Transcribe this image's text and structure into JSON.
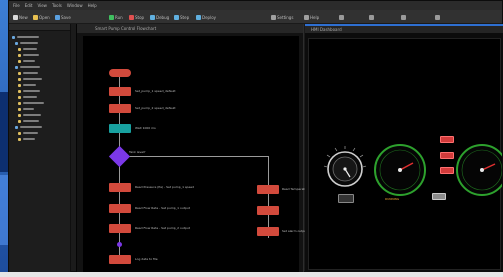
{
  "menubar": {
    "items": [
      "File",
      "Edit",
      "View",
      "Tools",
      "Window",
      "Help"
    ]
  },
  "toolbar": {
    "buttons": [
      {
        "label": "New",
        "color": "#d9d9d9"
      },
      {
        "label": "Open",
        "color": "#e8c050"
      },
      {
        "label": "Save",
        "color": "#5aa0e0"
      },
      {
        "label": "Run",
        "color": "#40c060"
      },
      {
        "label": "Stop",
        "color": "#e05050"
      },
      {
        "label": "Debug",
        "color": "#60b0e0"
      },
      {
        "label": "Step",
        "color": "#60b0e0"
      },
      {
        "label": "Deploy",
        "color": "#60b0e0"
      },
      {
        "label": "Settings",
        "color": "#a0a0a0"
      },
      {
        "label": "Help",
        "color": "#a0a0a0"
      }
    ]
  },
  "flow": {
    "tab_label": "Smart Pump Control Flowchart",
    "nodes": [
      {
        "kind": "start",
        "text": ""
      },
      {
        "kind": "block",
        "text": "Set_pump_1 speed_default"
      },
      {
        "kind": "block",
        "text": "Set_pump_2 speed_default"
      },
      {
        "kind": "teal",
        "text": "Wait 1000 ms"
      },
      {
        "kind": "decision",
        "text": "Tank level?"
      },
      {
        "kind": "block",
        "text": "Read Pressure (Pa) - Set pump_1 speed"
      },
      {
        "kind": "block",
        "text": "Read Flow Rate - Set pump_1 output"
      },
      {
        "kind": "block",
        "text": "Read Flow Rate - Set pump_2 output"
      },
      {
        "kind": "block",
        "text": "Read Temperature - Set fan speed"
      },
      {
        "kind": "block",
        "text": "Set alarm output"
      },
      {
        "kind": "block",
        "text": "Log data to file"
      }
    ]
  },
  "hmi": {
    "tab_label": "HMI Dashboard",
    "status_label": "RUNNING",
    "buttons": [
      "START",
      "STOP",
      "RESET",
      "AUTO",
      "MANUAL"
    ]
  }
}
